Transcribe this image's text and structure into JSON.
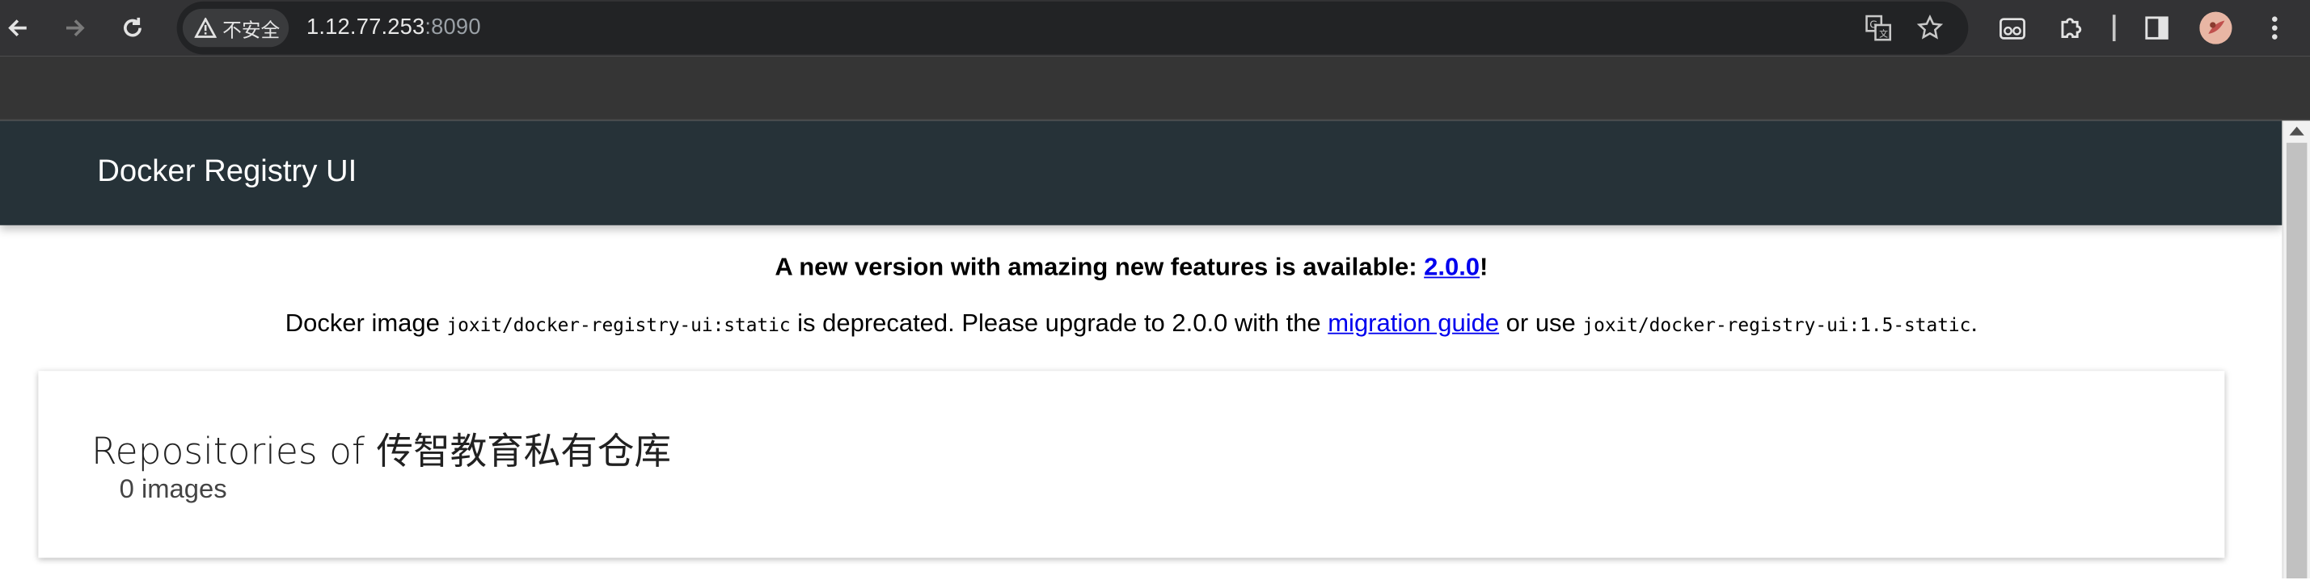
{
  "browser": {
    "security_label": "不安全",
    "url_host": "1.12.77.253",
    "url_port": ":8090"
  },
  "header": {
    "title": "Docker Registry UI"
  },
  "notice": {
    "line1_text": "A new version with amazing new features is available: ",
    "line1_link": "2.0.0",
    "line1_end": "!",
    "line2_pre": "Docker image ",
    "line2_code1": "joxit/docker-registry-ui:static",
    "line2_mid": " is deprecated. Please upgrade to 2.0.0 with the ",
    "line2_link": "migration guide",
    "line2_or": " or use ",
    "line2_code2": "joxit/docker-registry-ui:1.5-static",
    "line2_end": "."
  },
  "repositories": {
    "title": "Repositories of 传智教育私有仓库",
    "count_label": "0 images"
  }
}
